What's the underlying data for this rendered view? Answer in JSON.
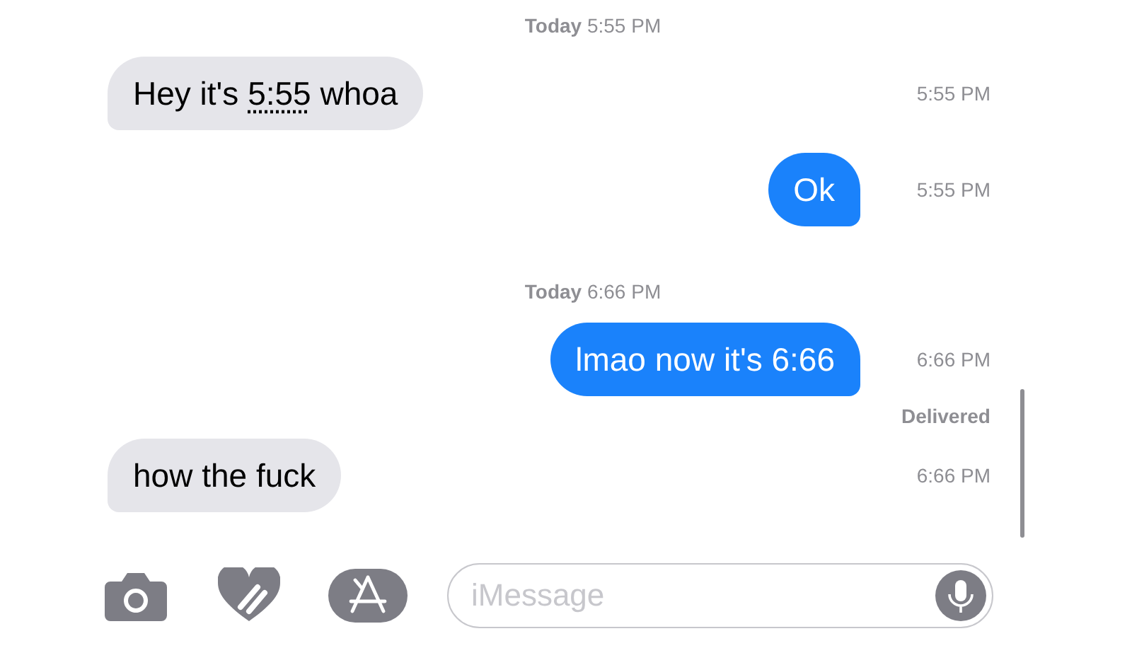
{
  "conversation": [
    {
      "kind": "separator",
      "day": "Today",
      "time": "5:55 PM"
    },
    {
      "kind": "message",
      "outgoing": false,
      "parts": [
        {
          "text": "Hey it's "
        },
        {
          "text": "5:55",
          "kind": "link"
        },
        {
          "text": " whoa"
        }
      ],
      "time": "5:55 PM"
    },
    {
      "kind": "message",
      "outgoing": true,
      "parts": [
        {
          "text": "Ok"
        }
      ],
      "time": "5:55 PM"
    },
    {
      "kind": "separator",
      "day": "Today",
      "time": "6:66 PM"
    },
    {
      "kind": "message",
      "outgoing": true,
      "parts": [
        {
          "text": "lmao now it's 6:66"
        }
      ],
      "time": "6:66 PM",
      "status": "Delivered"
    },
    {
      "kind": "message",
      "outgoing": false,
      "parts": [
        {
          "text": "how the fuck"
        }
      ],
      "time": "6:66 PM"
    }
  ],
  "compose": {
    "placeholder": "iMessage"
  }
}
